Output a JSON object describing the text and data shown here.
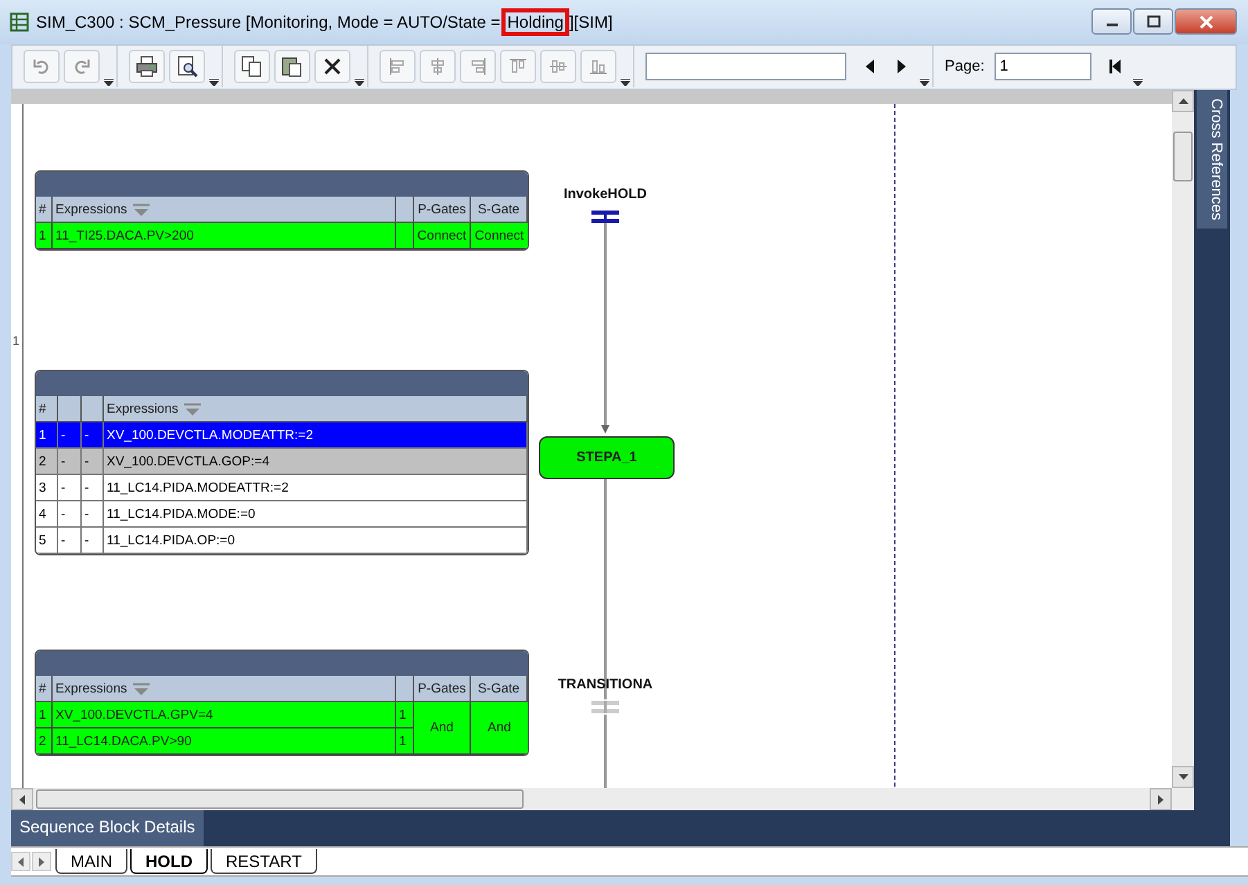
{
  "window": {
    "title_start": "SIM_C300 : SCM_Pressure [Monitoring, Mode  = AUTO/State =",
    "title_highlight": "Holding",
    "title_end": "][SIM]"
  },
  "toolbar": {
    "page_label": "Page:",
    "page_value": "1"
  },
  "canvas": {
    "page_marker": "1"
  },
  "side_panel": {
    "tab": "Cross References"
  },
  "tables": [
    {
      "kind": "gate",
      "columns": {
        "num": "#",
        "expression": "Expressions",
        "p_gate": "P-Gates",
        "s_gate": "S-Gate"
      },
      "rows": [
        {
          "num": "1",
          "expression": "11_TI25.DACA.PV>200",
          "met": true
        }
      ],
      "p_gate": "Connect",
      "s_gate": "Connect"
    },
    {
      "kind": "action",
      "columns": {
        "num": "#",
        "expression": "Expressions"
      },
      "rows": [
        {
          "num": "1",
          "col_2": "-",
          "col_3": "-",
          "expression": "XV_100.DEVCTLA.MODEATTR:=2",
          "selected": true,
          "executed": false
        },
        {
          "num": "2",
          "col_2": "-",
          "col_3": "-",
          "expression": "XV_100.DEVCTLA.GOP:=4",
          "selected": false,
          "executed": true
        },
        {
          "num": "3",
          "col_2": "-",
          "col_3": "-",
          "expression": "11_LC14.PIDA.MODEATTR:=2",
          "selected": false,
          "executed": false
        },
        {
          "num": "4",
          "col_2": "-",
          "col_3": "-",
          "expression": "11_LC14.PIDA.MODE:=0",
          "selected": false,
          "executed": false
        },
        {
          "num": "5",
          "col_2": "-",
          "col_3": "-",
          "expression": "11_LC14.PIDA.OP:=0",
          "selected": false,
          "executed": false
        }
      ]
    },
    {
      "kind": "gate",
      "columns": {
        "num": "#",
        "expression": "Expressions",
        "p_gate": "P-Gates",
        "s_gate": "S-Gate"
      },
      "rows": [
        {
          "num": "1",
          "expression": "XV_100.DEVCTLA.GPV=4",
          "count": "1",
          "met": true
        },
        {
          "num": "2",
          "expression": "11_LC14.DACA.PV>90",
          "count": "1",
          "met": true
        }
      ],
      "p_gate": "And",
      "s_gate": "And"
    }
  ],
  "diagram": {
    "transitions": [
      {
        "label": "InvokeHOLD",
        "active": true
      },
      {
        "label": "TRANSITIONA",
        "active": false
      }
    ],
    "steps": [
      {
        "label": "STEPA_1",
        "active": true
      }
    ]
  },
  "details_panel": {
    "title": "Sequence Block Details"
  },
  "sheet_tabs": [
    {
      "label": "MAIN",
      "selected": false
    },
    {
      "label": "HOLD",
      "selected": true
    },
    {
      "label": "RESTART",
      "selected": false
    }
  ]
}
